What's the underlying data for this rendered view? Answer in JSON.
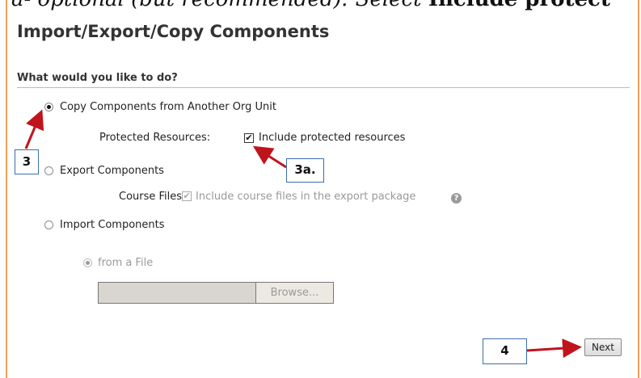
{
  "background_text": {
    "italic": "a- optional (but recommended): Select",
    "bold": "Include protect"
  },
  "page": {
    "title": "Import/Export/Copy Components",
    "section_title": "What would you like to do?"
  },
  "options": {
    "copy": {
      "label": "Copy Components from Another Org Unit",
      "checked": true
    },
    "protected_resources": {
      "label": "Protected Resources:",
      "checkbox_label": "Include protected resources",
      "checked": true
    },
    "export": {
      "label": "Export Components",
      "checked": false
    },
    "course_files": {
      "label": "Course Files:",
      "checkbox_label": "Include course files in the export package",
      "checked": true,
      "disabled": true
    },
    "import": {
      "label": "Import Components",
      "checked": false
    },
    "from_file": {
      "label": "from a File",
      "checked": true,
      "disabled": true
    }
  },
  "file_input": {
    "value": ""
  },
  "buttons": {
    "browse": "Browse...",
    "next": "Next"
  },
  "callouts": {
    "step3": "3",
    "step3a": "3a.",
    "step4": "4"
  },
  "icons": {
    "help": "help-icon",
    "checkmark": "✔"
  },
  "colors": {
    "accent_border": "#f0a054",
    "arrow": "#c0141c",
    "callout_border": "#3b6faa"
  }
}
